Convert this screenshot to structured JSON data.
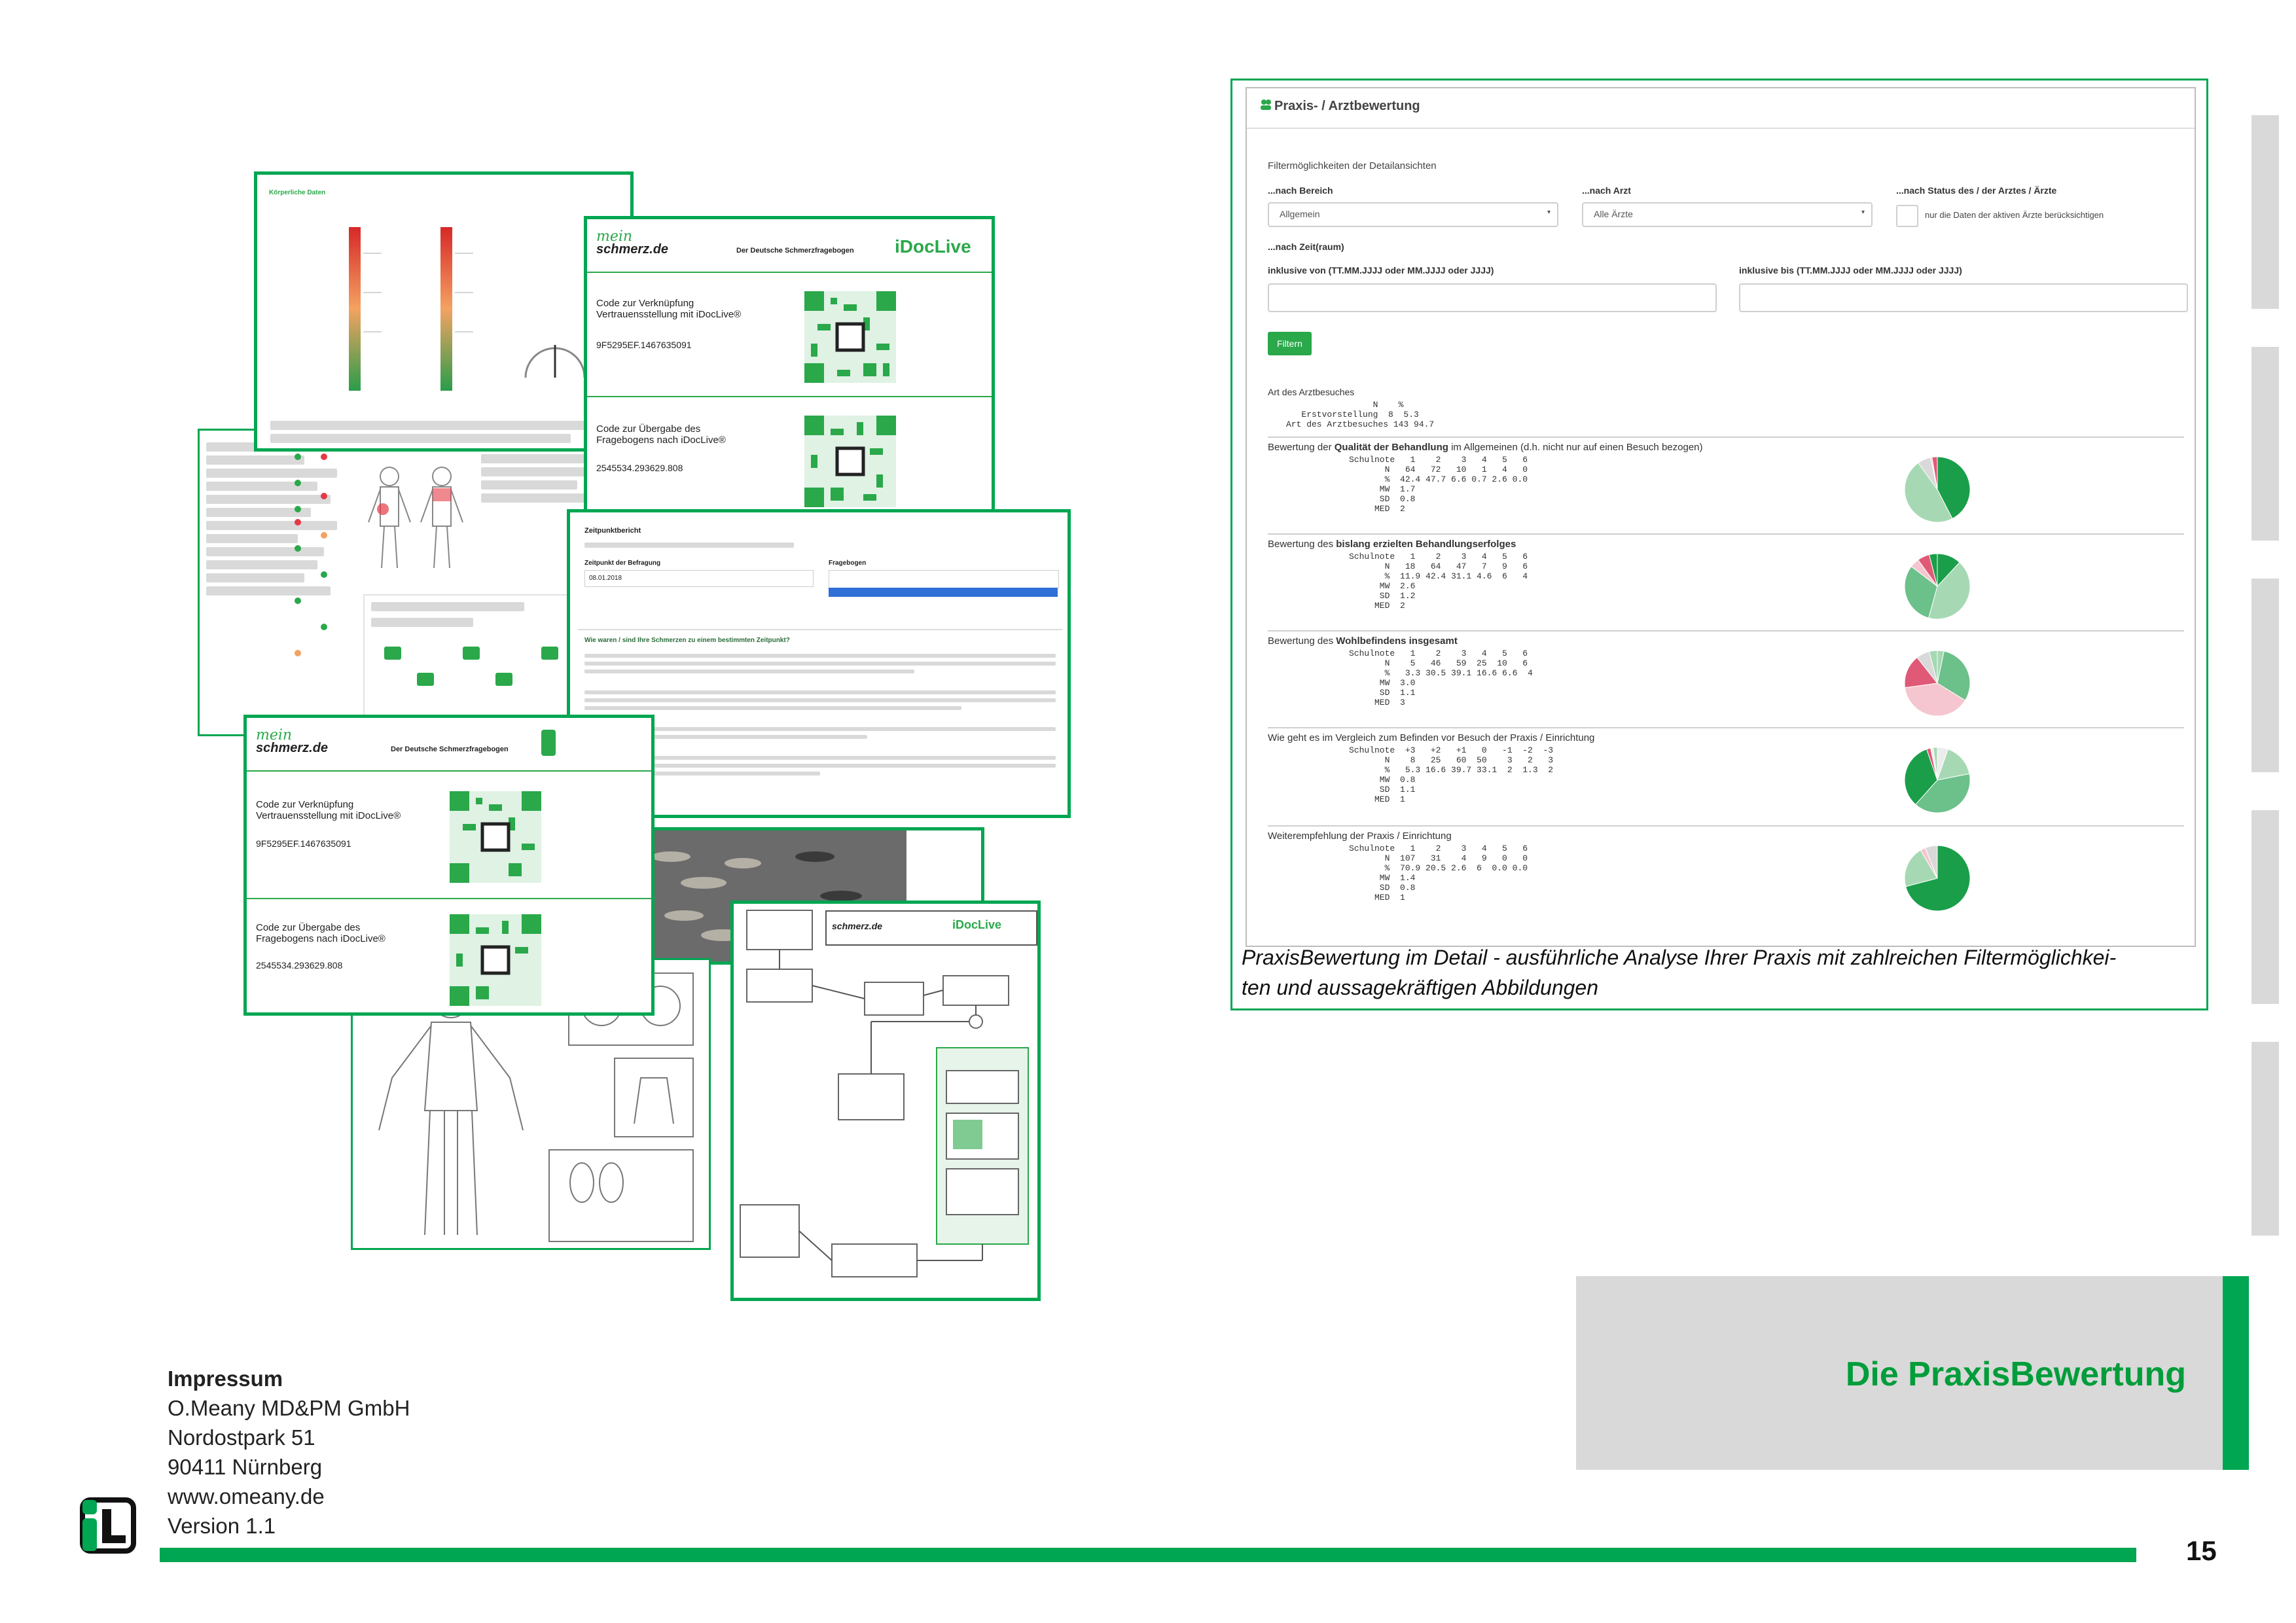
{
  "praxis": {
    "title": "Praxis- / Arztbewertung",
    "filter_header": "Filtermöglichkeiten der Detailansichten",
    "bereich_label": "...nach Bereich",
    "bereich_value": "Allgemein",
    "arzt_label": "...nach Arzt",
    "arzt_value": "Alle Ärzte",
    "status_label": "...nach Status des / der Arztes / Ärzte",
    "status_checkbox": "nur die Daten der aktiven Ärzte berücksichtigen",
    "zeit_label": "...nach Zeit(raum)",
    "von_label": "inklusive von (TT.MM.JJJJ oder MM.JJJJ oder JJJJ)",
    "bis_label": "inklusive bis (TT.MM.JJJJ oder MM.JJJJ oder JJJJ)",
    "filter_button": "Filtern",
    "art_title": "Art des Arztbesuches",
    "art_rows": [
      "                 N    %",
      "   Erstvorstellung  8  5.3",
      "Art des Arztbesuches 143 94.7"
    ],
    "sections": [
      {
        "title_pre": "Bewertung der ",
        "title_bold": "Qualität der Behandlung",
        "title_post": " im Allgemeinen (d.h. nicht nur auf einen Besuch bezogen)",
        "rows": [
          "Schulnote   1    2    3   4   5   6",
          "       N   64   72   10   1   4   0",
          "       %  42.4 47.7 6.6 0.7 2.6 0.0",
          "      MW  1.7",
          "      SD  0.8",
          "     MED  2"
        ]
      },
      {
        "title_pre": "Bewertung des ",
        "title_bold": "bislang erzielten Behandlungserfolges",
        "title_post": "",
        "rows": [
          "Schulnote   1    2    3   4   5   6",
          "       N   18   64   47   7   9   6",
          "       %  11.9 42.4 31.1 4.6  6   4",
          "      MW  2.6",
          "      SD  1.2",
          "     MED  2"
        ]
      },
      {
        "title_pre": "Bewertung des ",
        "title_bold": "Wohlbefindens insgesamt",
        "title_post": "",
        "rows": [
          "Schulnote   1    2    3   4   5   6",
          "       N    5   46   59  25  10   6",
          "       %   3.3 30.5 39.1 16.6 6.6  4",
          "      MW  3.0",
          "      SD  1.1",
          "     MED  3"
        ]
      },
      {
        "title_pre": "Wie geht es im Vergleich zum Befinden vor Besuch der Praxis / Einrichtung",
        "title_bold": "",
        "title_post": "",
        "rows": [
          "Schulnote  +3   +2   +1   0   -1  -2  -3",
          "       N    8   25   60  50    3   2   3",
          "       %   5.3 16.6 39.7 33.1  2  1.3  2",
          "      MW  0.8",
          "      SD  1.1",
          "     MED  1"
        ]
      },
      {
        "title_pre": "Weiterempfehlung der Praxis / Einrichtung",
        "title_bold": "",
        "title_post": "",
        "rows": [
          "Schulnote   1    2    3   4   5   6",
          "       N  107   31    4   9   0   0",
          "       %  70.9 20.5 2.6  6  0.0 0.0",
          "      MW  1.4",
          "      SD  0.8",
          "     MED  1"
        ]
      }
    ]
  },
  "caption": {
    "line1": "PraxisBewertung im Detail - ausführliche Analyse Ihrer Praxis mit zahlreichen Filtermöglichkei-",
    "line2": "ten und aussagekräftigen Abbildungen"
  },
  "collage": {
    "brand_mein": "mein",
    "brand_schmerz": "schmerz.de",
    "brand_idoc": "iDocLive",
    "subtitle": "Der Deutsche Schmerzfragebogen",
    "code1_label": "Code zur Verknüpfung Vertrauensstellung mit iDocLive®",
    "code1_value": "9F5295EF.1467635091",
    "code2_label": "Code zur Übergabe des Fragebogens nach iDocLive®",
    "code2_value": "2545534.293629.808",
    "body_data_title": "Körperliche Daten",
    "zeitpunkt_title": "Zeitpunktbericht",
    "zeitpunkt_date_label": "Zeitpunkt der Befragung",
    "zeitpunkt_date": "08.01.2018",
    "fragebogen_label": "Fragebogen",
    "question": "Wie waren / sind Ihre Schmerzen zu einem bestimmten Zeitpunkt?"
  },
  "impressum": {
    "title": "Impressum",
    "company": "O.Meany MD&PM GmbH",
    "street": "Nordostpark 51",
    "city": "90411 Nürnberg",
    "web": "www.omeany.de",
    "version": "Version 1.1"
  },
  "section_title": "Die PraxisBewertung",
  "page_number": "15",
  "colors": {
    "brand_green": "#00a651",
    "title_green": "#009d3a",
    "gray": "#d9d9d9"
  }
}
